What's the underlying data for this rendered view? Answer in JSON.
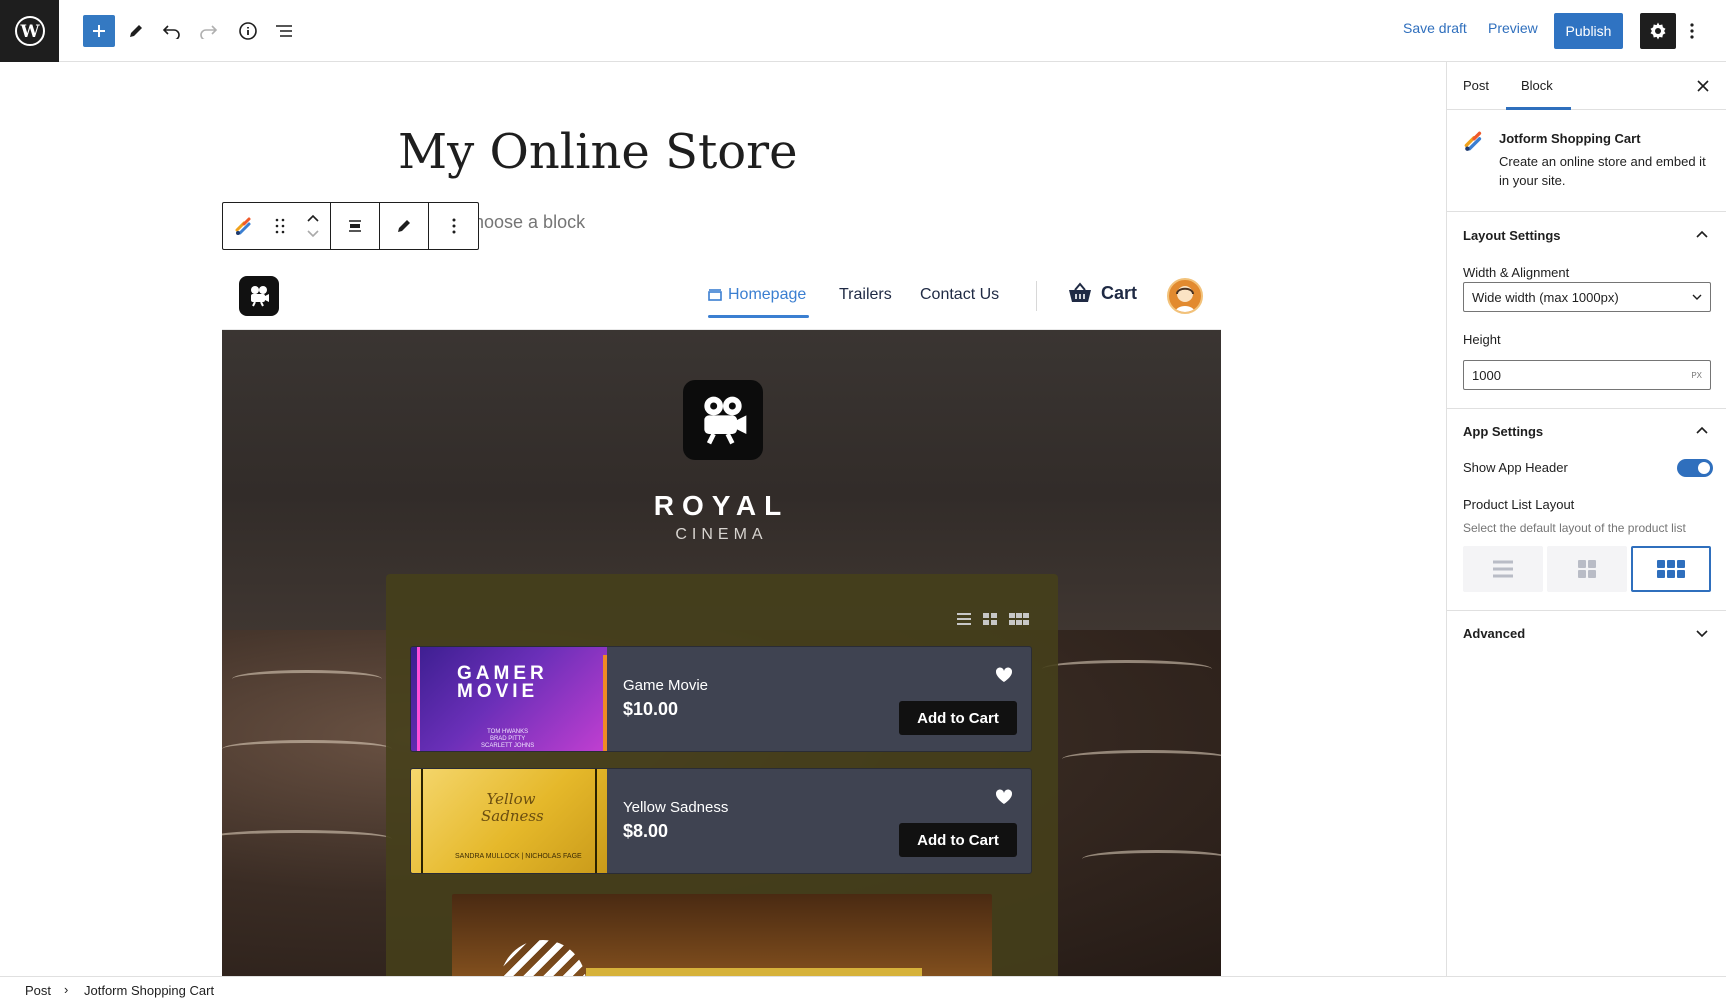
{
  "topbar": {
    "save_draft": "Save draft",
    "preview": "Preview",
    "publish": "Publish"
  },
  "editor": {
    "post_title": "My Online Store",
    "block_placeholder": "hoose a block"
  },
  "app": {
    "nav": {
      "items": [
        "Homepage",
        "Trailers",
        "Contact Us"
      ],
      "cart": "Cart"
    },
    "brand": {
      "name": "ROYAL",
      "subtitle": "CINEMA"
    },
    "products": [
      {
        "name": "Game Movie",
        "price": "$10.00",
        "button": "Add to Cart",
        "poster_title": "GAMER MOVIE",
        "poster_cast": [
          "TOM HWANKS",
          "BRAD PITTY",
          "SCARLETT JOHNS"
        ]
      },
      {
        "name": "Yellow Sadness",
        "price": "$8.00",
        "button": "Add to Cart",
        "poster_title": "Yellow Sadness",
        "poster_cast": [
          "SANDRA MULLOCK | NICHOLAS FAGE"
        ]
      }
    ]
  },
  "sidebar": {
    "tabs": [
      "Post",
      "Block"
    ],
    "active_tab": "Block",
    "block": {
      "title": "Jotform Shopping Cart",
      "description": "Create an online store and embed it in your site."
    },
    "layout_settings": {
      "title": "Layout Settings",
      "width_label": "Width & Alignment",
      "width_value": "Wide width (max 1000px)",
      "height_label": "Height",
      "height_value": "1000",
      "height_unit": "PX"
    },
    "app_settings": {
      "title": "App Settings",
      "show_header_label": "Show App Header",
      "show_header_on": true,
      "product_layout_label": "Product List Layout",
      "product_layout_help": "Select the default layout of the product list",
      "selected_layout": "grid-3"
    },
    "advanced": {
      "title": "Advanced"
    }
  },
  "footer": {
    "breadcrumb": [
      "Post",
      "Jotform Shopping Cart"
    ]
  },
  "colors": {
    "accent": "#2f6fbd",
    "publish": "#2f73c2",
    "nav_active": "#3b7fd1"
  }
}
